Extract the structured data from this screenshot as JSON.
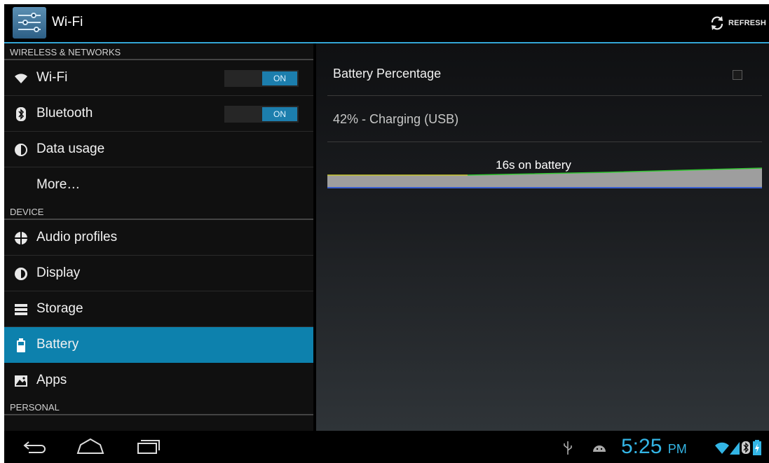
{
  "action_bar": {
    "icon": "settings-sliders-icon",
    "title": "Wi-Fi",
    "refresh_label": "REFRESH",
    "refresh_icon": "refresh-icon"
  },
  "sidebar": {
    "sections": [
      {
        "header": "WIRELESS & NETWORKS"
      },
      {
        "header": "DEVICE"
      },
      {
        "header": "PERSONAL"
      }
    ],
    "items": [
      {
        "label": "Wi-Fi",
        "icon": "wifi-icon",
        "toggle": "ON"
      },
      {
        "label": "Bluetooth",
        "icon": "bluetooth-icon",
        "toggle": "ON"
      },
      {
        "label": "Data usage",
        "icon": "data-usage-icon"
      },
      {
        "label": "More…"
      },
      {
        "label": "Audio profiles",
        "icon": "audio-profiles-icon"
      },
      {
        "label": "Display",
        "icon": "display-icon"
      },
      {
        "label": "Storage",
        "icon": "storage-icon"
      },
      {
        "label": "Battery",
        "icon": "battery-icon",
        "selected": true
      },
      {
        "label": "Apps",
        "icon": "apps-icon"
      }
    ]
  },
  "battery_pane": {
    "battery_percentage_label": "Battery Percentage",
    "battery_percentage_checked": false,
    "status": "42% - Charging (USB)",
    "graph_label": "16s on battery"
  },
  "status_bar": {
    "time": "5:25",
    "ampm": "PM",
    "icons": [
      "usb-icon",
      "android-debug-icon",
      "wifi-signal-icon",
      "cell-signal-icon",
      "bluetooth-status-icon",
      "battery-charging-icon"
    ]
  },
  "nav": {
    "buttons": [
      "back-icon",
      "home-icon",
      "recent-apps-icon"
    ]
  },
  "colors": {
    "accent": "#33b5e5",
    "selected": "#0d81ad",
    "toggle_on": "#1c7ead"
  }
}
